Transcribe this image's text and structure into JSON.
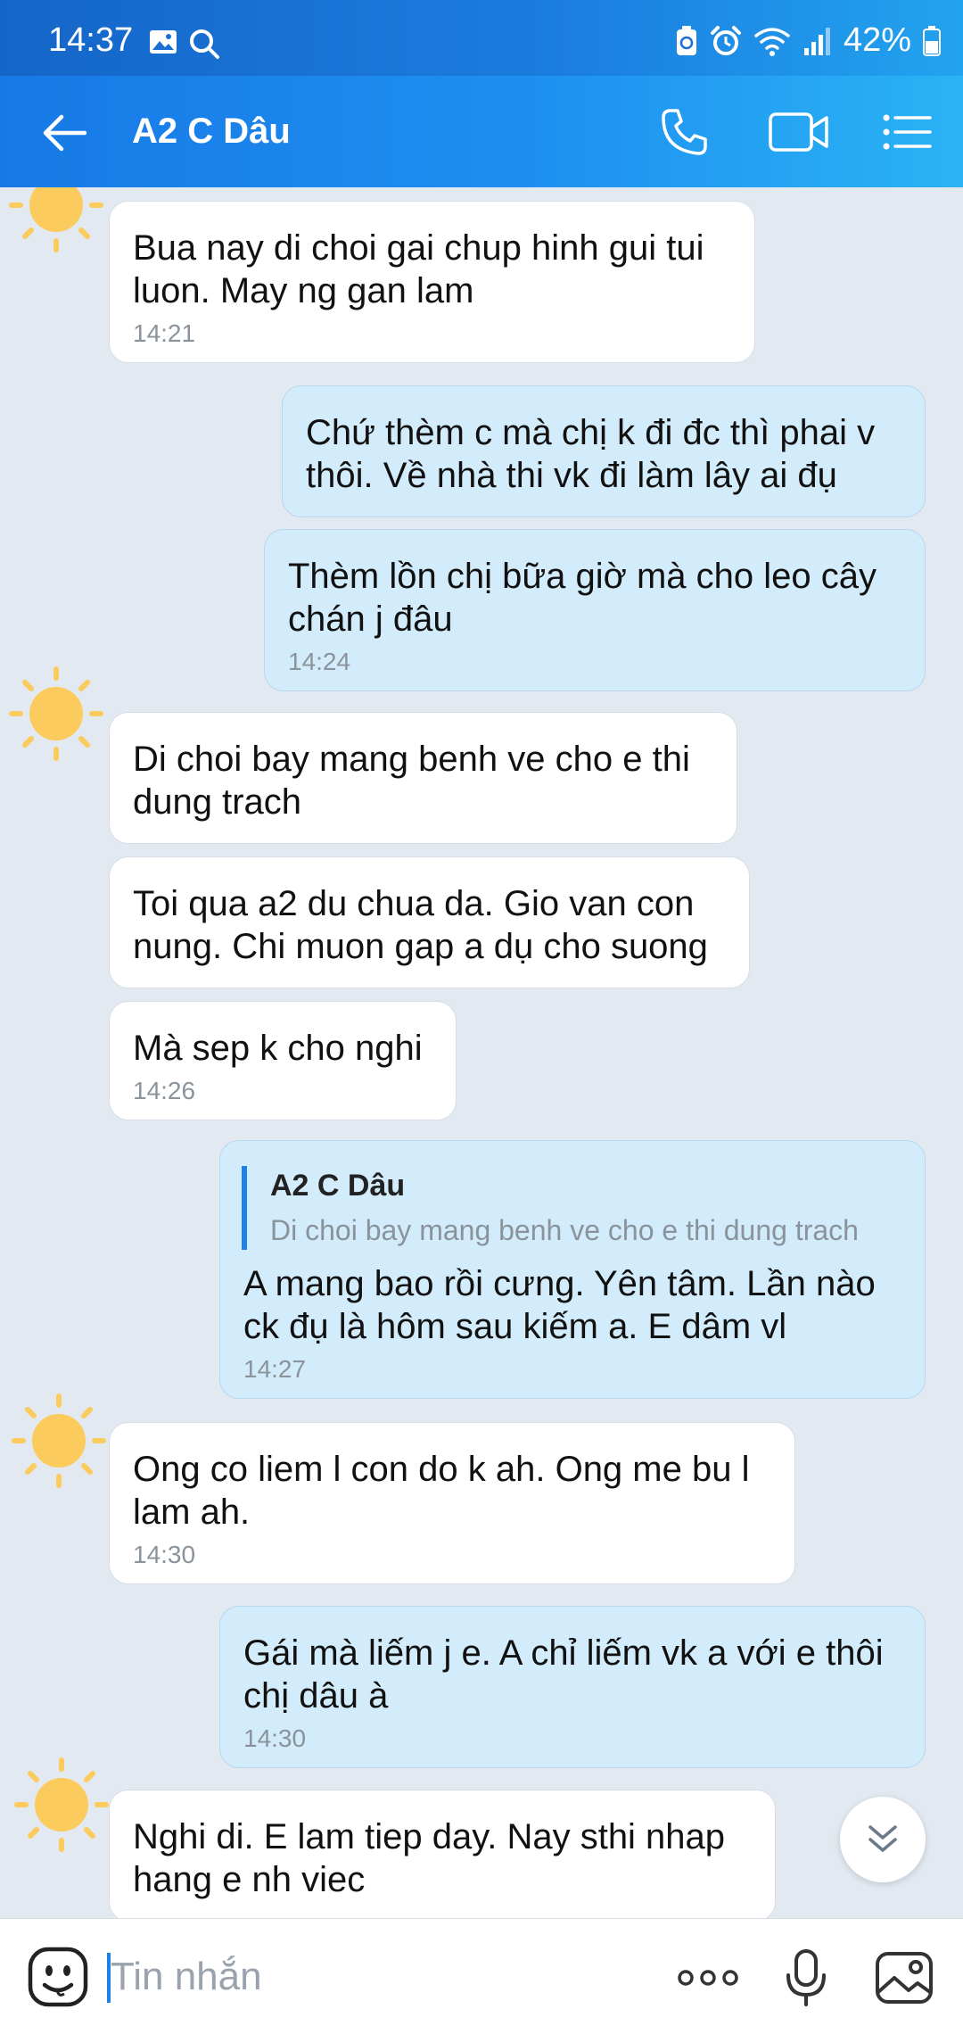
{
  "status_bar": {
    "time": "14:37",
    "battery": "42%"
  },
  "header": {
    "title": "A2 C Dâu"
  },
  "messages": [
    {
      "text": "Bua nay di choi gai chup hinh gui tui\nluon. May ng gan lam",
      "time": "14:21"
    },
    {
      "text": "Chứ thèm c mà chị k đi đc thì phai v\nthôi. Về nhà thi vk đi làm lây ai đụ"
    },
    {
      "text": "Thèm lồn chị bữa giờ mà cho leo cây\nchán j đâu",
      "time": "14:24"
    },
    {
      "text": "Di choi bay mang benh ve cho e thi\ndung trach"
    },
    {
      "text": "Toi qua a2 du chua da. Gio van con\nnung. Chi muon gap a dụ cho suong"
    },
    {
      "text": "Mà sep k cho nghi",
      "time": "14:26"
    },
    {
      "quote_name": "A2 C Dâu",
      "quote_text": "Di choi bay mang benh ve cho e thi dung trach",
      "text": "A mang bao rồi cưng. Yên tâm. Lần nào\nck đụ là hôm sau kiếm a. E dâm vl",
      "time": "14:27"
    },
    {
      "text": "Ong co liem l con do k ah. Ong me bu l\nlam ah.",
      "time": "14:30"
    },
    {
      "text": "Gái mà liếm j e. A chỉ liếm vk a với e thôi\nchị dâu à",
      "time": "14:30"
    },
    {
      "text": "Nghi di. E lam tiep day. Nay sthi nhap\nhang e nh viec"
    }
  ],
  "input": {
    "placeholder": "Tin nhắn"
  },
  "icons": {
    "back": "back-arrow-icon",
    "call": "phone-icon",
    "video": "video-camera-icon",
    "menu": "list-menu-icon",
    "emoji": "sticker-emoji-icon",
    "more": "more-dots-icon",
    "mic": "microphone-icon",
    "image": "image-icon",
    "scroll": "double-chevron-down-icon"
  },
  "colors": {
    "header_start": "#1779e6",
    "header_end": "#2ab3f5",
    "incoming_bubble": "#ffffff",
    "outgoing_bubble": "#d3ecfb",
    "chat_background": "#e2e9f1",
    "accent": "#1b82e6",
    "avatar_sun": "#fccb5e"
  }
}
